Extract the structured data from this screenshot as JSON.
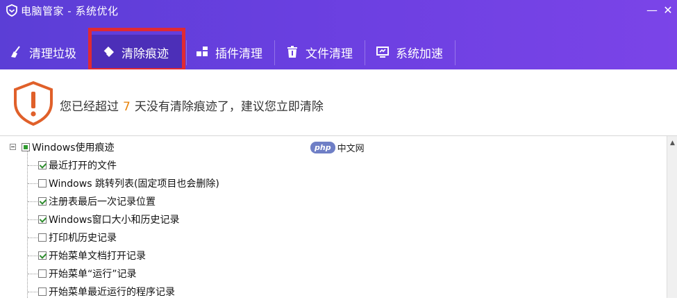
{
  "window": {
    "title": "电脑管家 - 系统优化",
    "minimize_glyph": "—",
    "close_glyph": "✕"
  },
  "tabs": [
    {
      "label": "清理垃圾",
      "icon": "broom-icon",
      "active": false
    },
    {
      "label": "清除痕迹",
      "icon": "eraser-icon",
      "active": true
    },
    {
      "label": "插件清理",
      "icon": "puzzle-icon",
      "active": false
    },
    {
      "label": "文件清理",
      "icon": "trash-icon",
      "active": false
    },
    {
      "label": "系统加速",
      "icon": "monitor-icon",
      "active": false
    }
  ],
  "notice": {
    "prefix": "您已经超过",
    "days": "7",
    "suffix": "天没有清除痕迹了，建议您立即清除",
    "icon": "warning-shield-icon"
  },
  "tree": {
    "root": {
      "label": "Windows使用痕迹",
      "state": "partial"
    },
    "items": [
      {
        "label": "最近打开的文件",
        "checked": true
      },
      {
        "label": "Windows 跳转列表(固定项目也会删除)",
        "checked": false
      },
      {
        "label": "注册表最后一次记录位置",
        "checked": true
      },
      {
        "label": "Windows窗口大小和历史记录",
        "checked": true
      },
      {
        "label": "打印机历史记录",
        "checked": false
      },
      {
        "label": "开始菜单文档打开记录",
        "checked": true
      },
      {
        "label": "开始菜单“运行”记录",
        "checked": false
      },
      {
        "label": "开始菜单最近运行的程序记录",
        "checked": false
      }
    ]
  },
  "watermark": {
    "badge": "php",
    "text": "中文网"
  },
  "colors": {
    "header": "#6a3fe0",
    "active_tab": "#4c2fb8",
    "highlight_border": "#e02a33",
    "days_accent": "#e8840c",
    "warning": "#e0602a"
  }
}
